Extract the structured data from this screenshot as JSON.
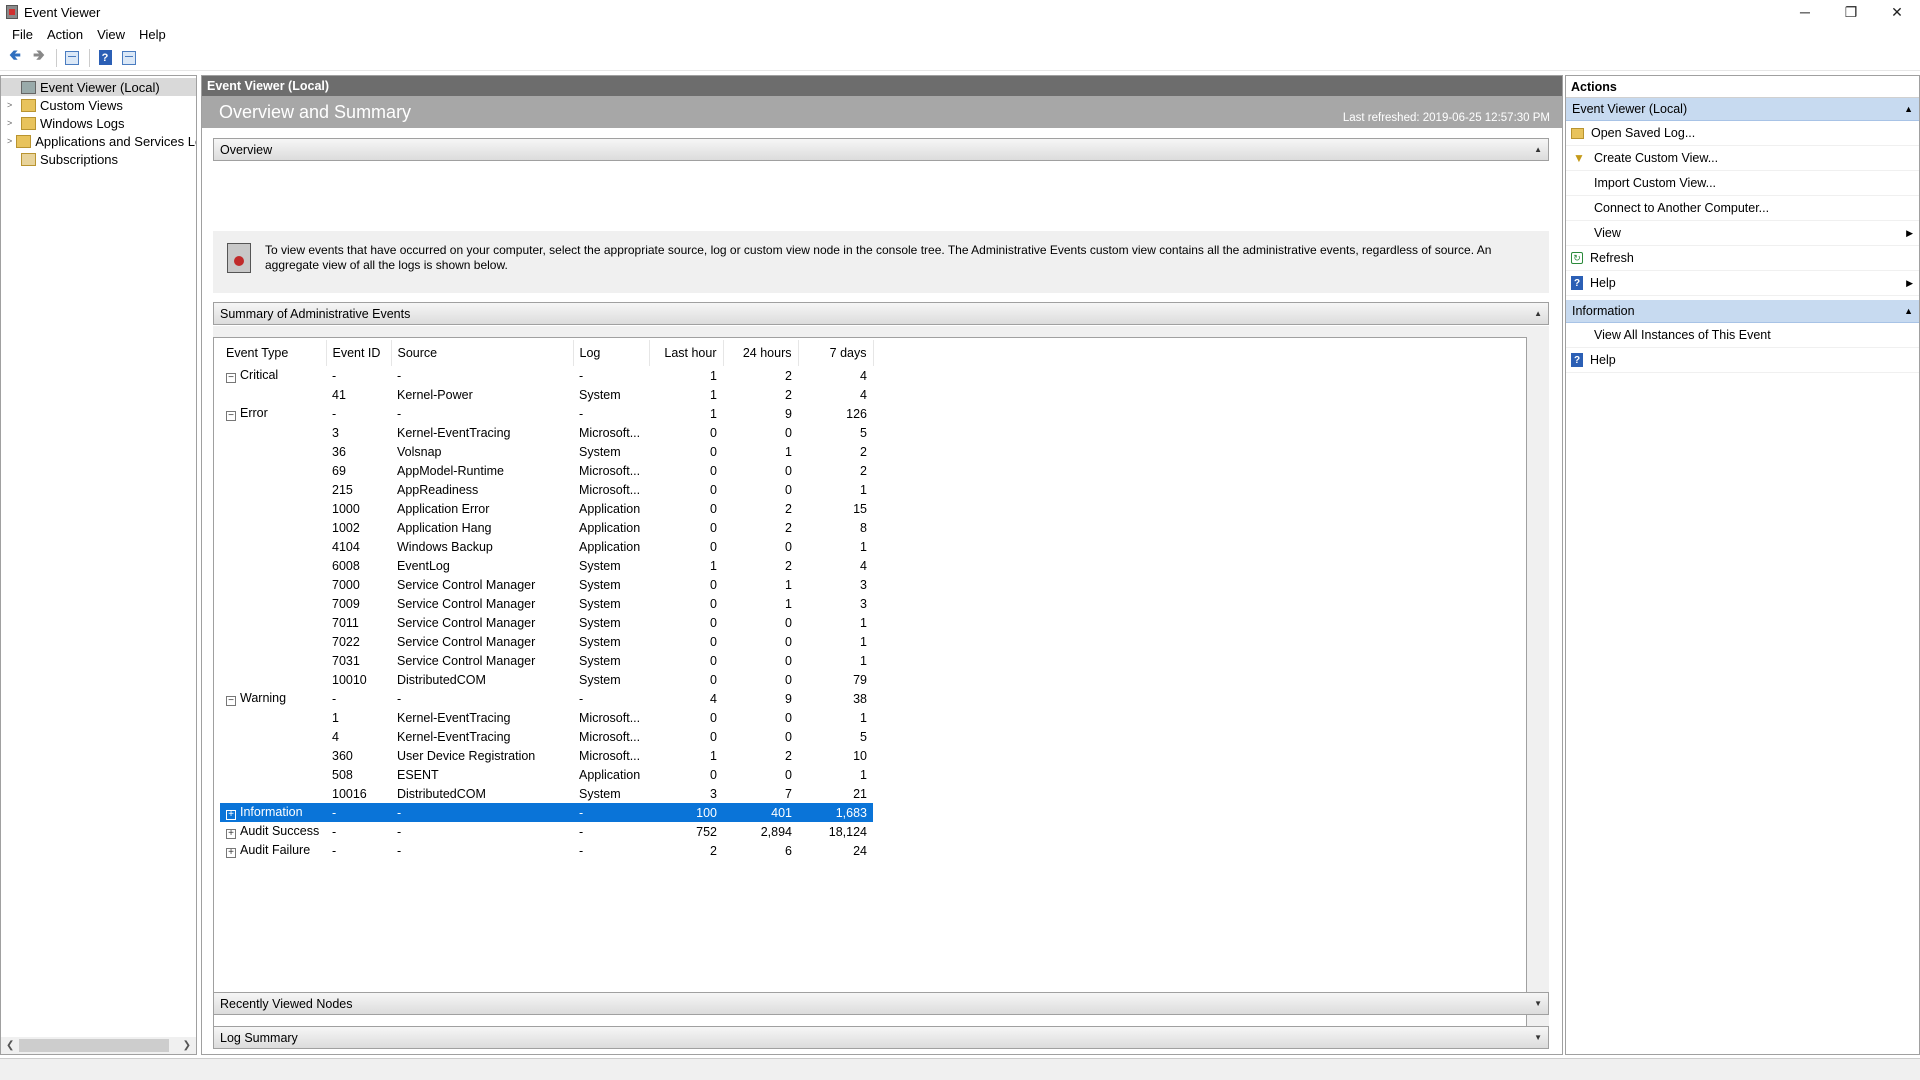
{
  "window": {
    "title": "Event Viewer",
    "controls": {
      "minimize": "─",
      "restore": "❐",
      "close": "✕"
    }
  },
  "menu": [
    "File",
    "Action",
    "View",
    "Help"
  ],
  "tree": {
    "items": [
      {
        "label": "Event Viewer (Local)",
        "icon": "event-viewer-icon",
        "expander": ""
      },
      {
        "label": "Custom Views",
        "icon": "folder-icon",
        "expander": ">"
      },
      {
        "label": "Windows Logs",
        "icon": "folder-icon",
        "expander": ">"
      },
      {
        "label": "Applications and Services Lo",
        "icon": "folder-icon",
        "expander": ">"
      },
      {
        "label": "Subscriptions",
        "icon": "subscriptions-icon",
        "expander": ""
      }
    ]
  },
  "center": {
    "header": "Event Viewer (Local)",
    "band_title": "Overview and Summary",
    "last_refreshed": "Last refreshed: 2019-06-25 12:57:30 PM",
    "overview_label": "Overview",
    "overview_text": "To view events that have occurred on your computer, select the appropriate source, log or custom view node in the console tree. The Administrative Events custom view contains all the administrative events, regardless of source. An aggregate view of all the logs is shown below.",
    "summary_label": "Summary of Administrative Events",
    "recent_label": "Recently Viewed Nodes",
    "logsum_label": "Log Summary",
    "columns": [
      "Event Type",
      "Event ID",
      "Source",
      "Log",
      "Last hour",
      "24 hours",
      "7 days"
    ],
    "rows": [
      {
        "type": "Critical",
        "pm": "−",
        "id": "-",
        "source": "-",
        "log": "-",
        "h": "1",
        "d": "2",
        "w": "4"
      },
      {
        "type": "",
        "pm": "",
        "id": "41",
        "source": "Kernel-Power",
        "log": "System",
        "h": "1",
        "d": "2",
        "w": "4"
      },
      {
        "type": "Error",
        "pm": "−",
        "id": "-",
        "source": "-",
        "log": "-",
        "h": "1",
        "d": "9",
        "w": "126"
      },
      {
        "type": "",
        "pm": "",
        "id": "3",
        "source": "Kernel-EventTracing",
        "log": "Microsoft...",
        "h": "0",
        "d": "0",
        "w": "5"
      },
      {
        "type": "",
        "pm": "",
        "id": "36",
        "source": "Volsnap",
        "log": "System",
        "h": "0",
        "d": "1",
        "w": "2"
      },
      {
        "type": "",
        "pm": "",
        "id": "69",
        "source": "AppModel-Runtime",
        "log": "Microsoft...",
        "h": "0",
        "d": "0",
        "w": "2"
      },
      {
        "type": "",
        "pm": "",
        "id": "215",
        "source": "AppReadiness",
        "log": "Microsoft...",
        "h": "0",
        "d": "0",
        "w": "1"
      },
      {
        "type": "",
        "pm": "",
        "id": "1000",
        "source": "Application Error",
        "log": "Application",
        "h": "0",
        "d": "2",
        "w": "15"
      },
      {
        "type": "",
        "pm": "",
        "id": "1002",
        "source": "Application Hang",
        "log": "Application",
        "h": "0",
        "d": "2",
        "w": "8"
      },
      {
        "type": "",
        "pm": "",
        "id": "4104",
        "source": "Windows Backup",
        "log": "Application",
        "h": "0",
        "d": "0",
        "w": "1"
      },
      {
        "type": "",
        "pm": "",
        "id": "6008",
        "source": "EventLog",
        "log": "System",
        "h": "1",
        "d": "2",
        "w": "4"
      },
      {
        "type": "",
        "pm": "",
        "id": "7000",
        "source": "Service Control Manager",
        "log": "System",
        "h": "0",
        "d": "1",
        "w": "3"
      },
      {
        "type": "",
        "pm": "",
        "id": "7009",
        "source": "Service Control Manager",
        "log": "System",
        "h": "0",
        "d": "1",
        "w": "3"
      },
      {
        "type": "",
        "pm": "",
        "id": "7011",
        "source": "Service Control Manager",
        "log": "System",
        "h": "0",
        "d": "0",
        "w": "1"
      },
      {
        "type": "",
        "pm": "",
        "id": "7022",
        "source": "Service Control Manager",
        "log": "System",
        "h": "0",
        "d": "0",
        "w": "1"
      },
      {
        "type": "",
        "pm": "",
        "id": "7031",
        "source": "Service Control Manager",
        "log": "System",
        "h": "0",
        "d": "0",
        "w": "1"
      },
      {
        "type": "",
        "pm": "",
        "id": "10010",
        "source": "DistributedCOM",
        "log": "System",
        "h": "0",
        "d": "0",
        "w": "79"
      },
      {
        "type": "Warning",
        "pm": "−",
        "id": "-",
        "source": "-",
        "log": "-",
        "h": "4",
        "d": "9",
        "w": "38"
      },
      {
        "type": "",
        "pm": "",
        "id": "1",
        "source": "Kernel-EventTracing",
        "log": "Microsoft...",
        "h": "0",
        "d": "0",
        "w": "1"
      },
      {
        "type": "",
        "pm": "",
        "id": "4",
        "source": "Kernel-EventTracing",
        "log": "Microsoft...",
        "h": "0",
        "d": "0",
        "w": "5"
      },
      {
        "type": "",
        "pm": "",
        "id": "360",
        "source": "User Device Registration",
        "log": "Microsoft...",
        "h": "1",
        "d": "2",
        "w": "10"
      },
      {
        "type": "",
        "pm": "",
        "id": "508",
        "source": "ESENT",
        "log": "Application",
        "h": "0",
        "d": "0",
        "w": "1"
      },
      {
        "type": "",
        "pm": "",
        "id": "10016",
        "source": "DistributedCOM",
        "log": "System",
        "h": "3",
        "d": "7",
        "w": "21"
      },
      {
        "type": "Information",
        "pm": "+",
        "id": "-",
        "source": "-",
        "log": "-",
        "h": "100",
        "d": "401",
        "w": "1,683",
        "selected": true
      },
      {
        "type": "Audit Success",
        "pm": "+",
        "id": "-",
        "source": "-",
        "log": "-",
        "h": "752",
        "d": "2,894",
        "w": "18,124"
      },
      {
        "type": "Audit Failure",
        "pm": "+",
        "id": "-",
        "source": "-",
        "log": "-",
        "h": "2",
        "d": "6",
        "w": "24"
      }
    ]
  },
  "actions": {
    "title": "Actions",
    "sections": [
      {
        "label": "Event Viewer (Local)",
        "items": [
          {
            "label": "Open Saved Log...",
            "icon": "open-log-icon",
            "submenu": false
          },
          {
            "label": "Create Custom View...",
            "icon": "filter-icon",
            "submenu": false
          },
          {
            "label": "Import Custom View...",
            "icon": "",
            "submenu": false
          },
          {
            "label": "Connect to Another Computer...",
            "icon": "",
            "submenu": false
          },
          {
            "label": "View",
            "icon": "",
            "submenu": true
          },
          {
            "label": "Refresh",
            "icon": "refresh-icon",
            "submenu": false
          },
          {
            "label": "Help",
            "icon": "help-icon",
            "submenu": true
          }
        ]
      },
      {
        "label": "Information",
        "items": [
          {
            "label": "View All Instances of This Event",
            "icon": "",
            "submenu": false
          },
          {
            "label": "Help",
            "icon": "help-icon",
            "submenu": false
          }
        ]
      }
    ]
  },
  "colors": {
    "selection": "#0a74d8",
    "header_dark": "#6d6d6d",
    "band": "#a7a7a7",
    "action_section": "#c7daf0"
  }
}
